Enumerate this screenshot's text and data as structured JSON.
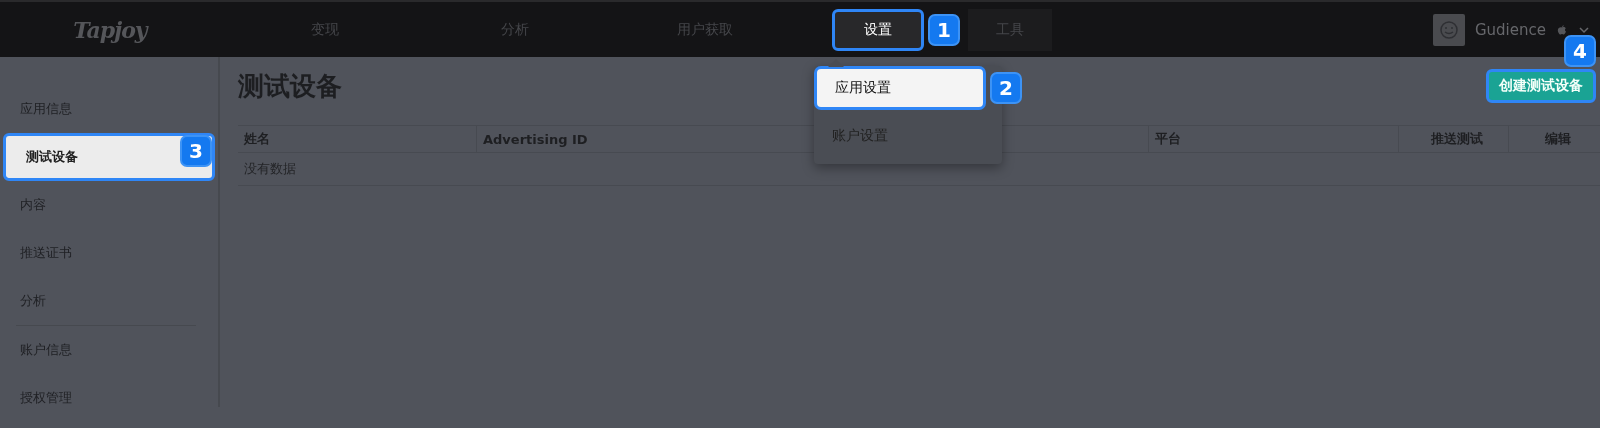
{
  "top_nav": {
    "logo": "Tapjoy",
    "items": [
      {
        "label": "变现",
        "selected": false
      },
      {
        "label": "分析",
        "selected": false
      },
      {
        "label": "用户获取",
        "selected": false
      },
      {
        "label": "设置",
        "selected": true,
        "callout": "1"
      },
      {
        "label": "工具",
        "selected": false
      }
    ],
    "user": {
      "name": "Gudience"
    }
  },
  "dropdown": {
    "items": [
      {
        "label": "应用设置",
        "selected": true,
        "callout": "2"
      },
      {
        "label": "账户设置",
        "selected": false
      }
    ]
  },
  "sidebar": {
    "groups": [
      {
        "items": [
          {
            "label": "应用信息",
            "selected": false
          },
          {
            "label": "测试设备",
            "selected": true,
            "callout": "3"
          },
          {
            "label": "内容",
            "selected": false
          },
          {
            "label": "推送证书",
            "selected": false
          },
          {
            "label": "分析",
            "selected": false
          }
        ]
      },
      {
        "items": [
          {
            "label": "账户信息",
            "selected": false
          },
          {
            "label": "授权管理",
            "selected": false
          }
        ]
      }
    ]
  },
  "page": {
    "title": "测试设备",
    "create_button": {
      "label": "创建测试设备",
      "callout": "4"
    },
    "table": {
      "columns": [
        "姓名",
        "Advertising ID",
        "平台",
        "推送测试",
        "编辑"
      ],
      "empty_text": "没有数据"
    }
  }
}
